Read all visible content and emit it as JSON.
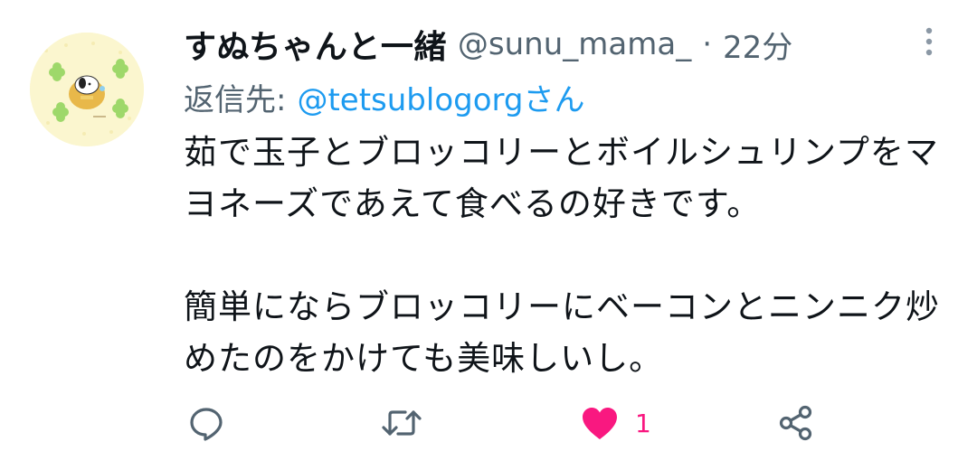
{
  "tweet": {
    "display_name": "すぬちゃんと一緒",
    "handle": "@sunu_mama_",
    "separator": "·",
    "time": "22分",
    "reply": {
      "prefix": "返信先:",
      "target": "@tetsublogorgさん"
    },
    "paragraphs": [
      "茹で玉子とブロッコリーとボイルシュリンプをマヨネーズであえて食べるの好きです。",
      "簡単にならブロッコリーにベーコンとニンニク炒めたのをかけても美味しいし。"
    ],
    "actions": {
      "reply_icon": "speech-bubble-icon",
      "retweet_icon": "retweet-icon",
      "like_icon": "heart-filled-icon",
      "like_count": "1",
      "share_icon": "share-icon"
    },
    "colors": {
      "text": "#0f1419",
      "secondary": "#536471",
      "link": "#1d9bf0",
      "like": "#f91880"
    }
  }
}
